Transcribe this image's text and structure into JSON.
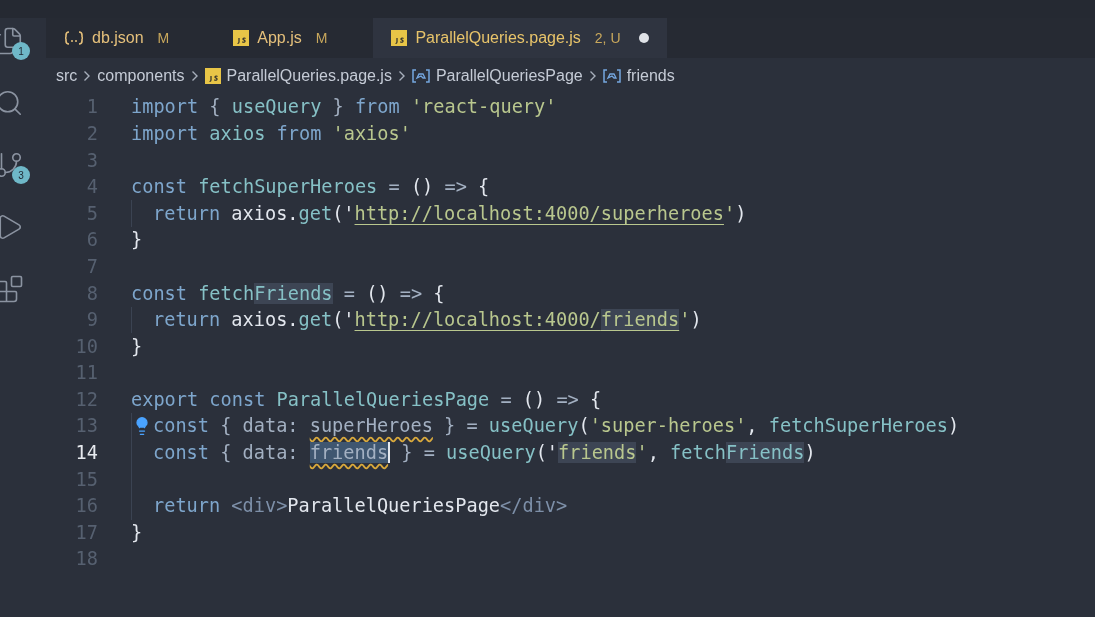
{
  "activity_bar": [
    {
      "kind": "files",
      "badge": "1"
    },
    {
      "kind": "search"
    },
    {
      "kind": "source-control",
      "badge": "3"
    },
    {
      "kind": "run"
    },
    {
      "kind": "extensions"
    }
  ],
  "tabs": [
    {
      "kind": "json",
      "label": "db.json",
      "status": "M",
      "selected": false,
      "dirty": false
    },
    {
      "kind": "js",
      "label": "App.js",
      "status": "M",
      "selected": false,
      "dirty": false
    },
    {
      "kind": "js",
      "label": "ParallelQueries.page.js",
      "status": "2, U",
      "selected": true,
      "dirty": true
    }
  ],
  "breadcrumb": [
    {
      "kind": "folder",
      "label": "src"
    },
    {
      "kind": "folder",
      "label": "components"
    },
    {
      "kind": "file",
      "label": "ParallelQueries.page.js"
    },
    {
      "kind": "symbol",
      "label": "ParallelQueriesPage"
    },
    {
      "kind": "symbol",
      "label": "friends"
    }
  ],
  "editor": {
    "lines": [
      {
        "number": "1",
        "current": false,
        "lightbulb": false,
        "indented": false,
        "tokens": [
          {
            "kind": "kw",
            "text": "import"
          },
          {
            "kind": "op",
            "text": " { "
          },
          {
            "kind": "fn",
            "text": "useQuery"
          },
          {
            "kind": "op",
            "text": " } "
          },
          {
            "kind": "kw",
            "text": "from"
          },
          {
            "kind": "str",
            "text": " 'react-query'"
          }
        ]
      },
      {
        "number": "2",
        "current": false,
        "lightbulb": false,
        "indented": false,
        "tokens": [
          {
            "kind": "kw",
            "text": "import"
          },
          {
            "kind": "fn",
            "text": " axios "
          },
          {
            "kind": "kw",
            "text": "from"
          },
          {
            "kind": "str",
            "text": " 'axios'"
          }
        ]
      },
      {
        "number": "3",
        "current": false,
        "lightbulb": false,
        "indented": false
      },
      {
        "number": "4",
        "current": false,
        "lightbulb": false,
        "indented": false,
        "tokens": [
          {
            "kind": "kw",
            "text": "const"
          },
          {
            "kind": "fn",
            "text": " fetchSuperHeroes"
          },
          {
            "kind": "op",
            "text": " = "
          },
          {
            "kind": "plain",
            "text": "()"
          },
          {
            "kind": "op",
            "text": " => "
          },
          {
            "kind": "plain",
            "text": "{"
          }
        ]
      },
      {
        "number": "5",
        "current": false,
        "lightbulb": false,
        "indented": true,
        "tokens": [
          {
            "kind": "kw",
            "text": "return"
          },
          {
            "kind": "plain",
            "text": " axios."
          },
          {
            "kind": "fn",
            "text": "get"
          },
          {
            "kind": "plain",
            "text": "('"
          },
          {
            "kind": "url",
            "text": "http://localhost:4000/superheroes"
          },
          {
            "kind": "str",
            "text": "'"
          },
          {
            "kind": "plain",
            "text": ")"
          }
        ]
      },
      {
        "number": "6",
        "current": false,
        "lightbulb": false,
        "indented": false,
        "tokens": [
          {
            "kind": "plain",
            "text": "}"
          }
        ]
      },
      {
        "number": "7",
        "current": false,
        "lightbulb": false,
        "indented": false
      },
      {
        "number": "8",
        "current": false,
        "lightbulb": false,
        "indented": false,
        "tokens": [
          {
            "kind": "kw",
            "text": "const"
          },
          {
            "kind": "fn",
            "text": " fetch"
          },
          {
            "kind": "fn",
            "text": "Friends",
            "highlighted": true
          },
          {
            "kind": "op",
            "text": " = "
          },
          {
            "kind": "plain",
            "text": "()"
          },
          {
            "kind": "op",
            "text": " => "
          },
          {
            "kind": "plain",
            "text": "{"
          }
        ]
      },
      {
        "number": "9",
        "current": false,
        "lightbulb": false,
        "indented": true,
        "tokens": [
          {
            "kind": "kw",
            "text": "return"
          },
          {
            "kind": "plain",
            "text": " axios."
          },
          {
            "kind": "fn",
            "text": "get"
          },
          {
            "kind": "plain",
            "text": "('"
          },
          {
            "kind": "url",
            "text": "http://localhost:4000/"
          },
          {
            "kind": "url",
            "text": "friends",
            "highlighted": true
          },
          {
            "kind": "str",
            "text": "'"
          },
          {
            "kind": "plain",
            "text": ")"
          }
        ]
      },
      {
        "number": "10",
        "current": false,
        "lightbulb": false,
        "indented": false,
        "tokens": [
          {
            "kind": "plain",
            "text": "}"
          }
        ]
      },
      {
        "number": "11",
        "current": false,
        "lightbulb": false,
        "indented": false
      },
      {
        "number": "12",
        "current": false,
        "lightbulb": false,
        "indented": false,
        "tokens": [
          {
            "kind": "kw",
            "text": "export const"
          },
          {
            "kind": "fn",
            "text": " ParallelQueriesPage"
          },
          {
            "kind": "op",
            "text": " = "
          },
          {
            "kind": "plain",
            "text": "()"
          },
          {
            "kind": "op",
            "text": " => "
          },
          {
            "kind": "plain",
            "text": "{"
          }
        ]
      },
      {
        "number": "13",
        "current": false,
        "lightbulb": true,
        "indented": true,
        "tokens": [
          {
            "kind": "kw",
            "text": "const"
          },
          {
            "kind": "op",
            "text": " { data: "
          },
          {
            "kind": "var",
            "text": "superHeroes",
            "warning": true
          },
          {
            "kind": "op",
            "text": " } = "
          },
          {
            "kind": "fn",
            "text": "useQuery"
          },
          {
            "kind": "plain",
            "text": "("
          },
          {
            "kind": "str",
            "text": "'super-heroes'"
          },
          {
            "kind": "plain",
            "text": ", "
          },
          {
            "kind": "fn",
            "text": "fetchSuperHeroes"
          },
          {
            "kind": "plain",
            "text": ")"
          }
        ]
      },
      {
        "number": "14",
        "current": true,
        "lightbulb": false,
        "indented": true,
        "tokens": [
          {
            "kind": "kw",
            "text": "const"
          },
          {
            "kind": "op",
            "text": " { data: "
          },
          {
            "kind": "var",
            "text": "friends",
            "selected": true,
            "warning": true,
            "cursor": true
          },
          {
            "kind": "op",
            "text": " } = "
          },
          {
            "kind": "fn",
            "text": "useQuery"
          },
          {
            "kind": "plain",
            "text": "('"
          },
          {
            "kind": "str",
            "text": "friends",
            "highlighted": true
          },
          {
            "kind": "str",
            "text": "'"
          },
          {
            "kind": "plain",
            "text": ", "
          },
          {
            "kind": "fn",
            "text": "fetch"
          },
          {
            "kind": "fn",
            "text": "Friends",
            "highlighted": true
          },
          {
            "kind": "plain",
            "text": ")"
          }
        ]
      },
      {
        "number": "15",
        "current": false,
        "lightbulb": false,
        "indented": true
      },
      {
        "number": "16",
        "current": false,
        "lightbulb": false,
        "indented": true,
        "tokens": [
          {
            "kind": "kw",
            "text": "return"
          },
          {
            "kind": "tag",
            "text": " <div>"
          },
          {
            "kind": "plain",
            "text": "ParallelQueriesPage"
          },
          {
            "kind": "tag",
            "text": "</div>"
          }
        ]
      },
      {
        "number": "17",
        "current": false,
        "lightbulb": false,
        "indented": false,
        "tokens": [
          {
            "kind": "plain",
            "text": "}"
          }
        ]
      },
      {
        "number": "18",
        "current": false,
        "lightbulb": false,
        "indented": false
      }
    ]
  }
}
